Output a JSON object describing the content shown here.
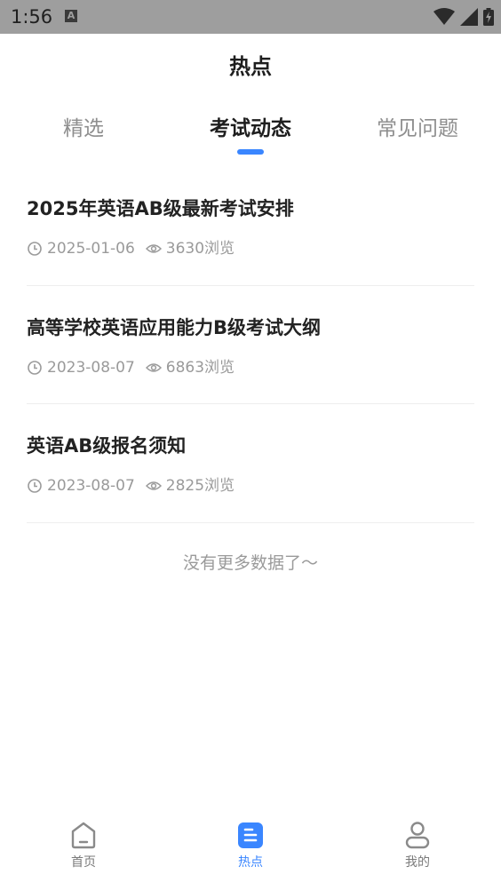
{
  "status_bar": {
    "time": "1:56",
    "a_icon_letter": "A"
  },
  "header": {
    "title": "热点"
  },
  "tabs": [
    {
      "label": "精选",
      "active": false
    },
    {
      "label": "考试动态",
      "active": true
    },
    {
      "label": "常见问题",
      "active": false
    }
  ],
  "articles": [
    {
      "title": "2025年英语AB级最新考试安排",
      "date": "2025-01-06",
      "views": "3630浏览"
    },
    {
      "title": "高等学校英语应用能力B级考试大纲",
      "date": "2023-08-07",
      "views": "6863浏览"
    },
    {
      "title": "英语AB级报名须知",
      "date": "2023-08-07",
      "views": "2825浏览"
    }
  ],
  "list_end_text": "没有更多数据了～",
  "bottom_nav": [
    {
      "label": "首页",
      "icon": "home-icon",
      "active": false
    },
    {
      "label": "热点",
      "icon": "document-icon",
      "active": true
    },
    {
      "label": "我的",
      "icon": "user-icon",
      "active": false
    }
  ],
  "colors": {
    "accent": "#3a86ff",
    "status_bar_bg": "#9e9e9e",
    "text_primary": "#222222",
    "text_secondary": "#9a9a9a"
  }
}
